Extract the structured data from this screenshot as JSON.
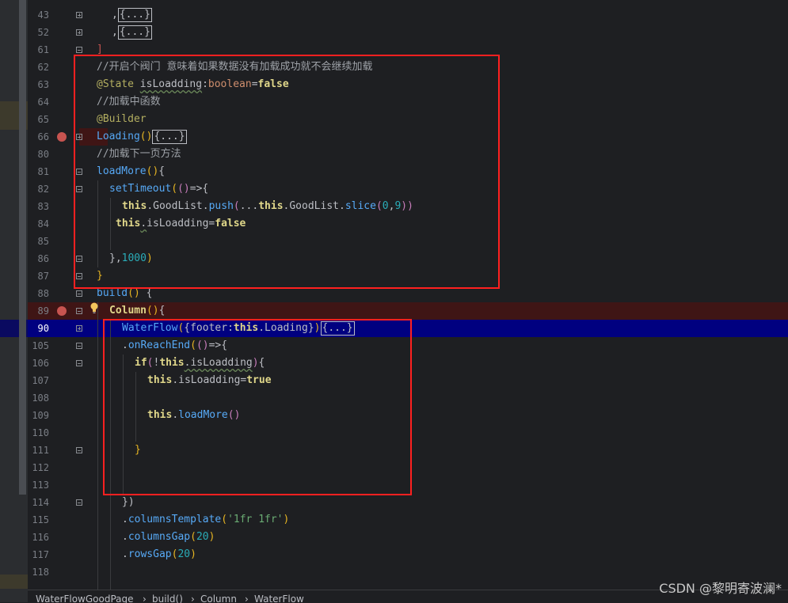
{
  "editor": {
    "lines": [
      {
        "num": "43",
        "tokens": [
          {
            "c": "plain",
            "t": ","
          },
          {
            "c": "fold",
            "t": "{...}"
          }
        ]
      },
      {
        "num": "52",
        "tokens": [
          {
            "c": "plain",
            "t": ","
          },
          {
            "c": "fold",
            "t": "{...}"
          }
        ]
      },
      {
        "num": "61",
        "tokens": [
          {
            "c": "redb",
            "t": "]"
          }
        ]
      },
      {
        "num": "62",
        "tokens": [
          {
            "c": "cmt",
            "t": "//开启个阀门 意味着如果数据没有加载成功就不会继续加载"
          }
        ]
      },
      {
        "num": "63",
        "tokens": [
          {
            "c": "ann",
            "t": "@State "
          },
          {
            "c": "plain",
            "t": "isLoadding"
          },
          {
            "c": "plain",
            "t": ":"
          },
          {
            "c": "kw",
            "t": "boolean"
          },
          {
            "c": "plain",
            "t": "="
          },
          {
            "c": "kwb",
            "t": "false"
          }
        ]
      },
      {
        "num": "64",
        "tokens": [
          {
            "c": "cmt",
            "t": "//加载中函数"
          }
        ]
      },
      {
        "num": "65",
        "tokens": [
          {
            "c": "ann",
            "t": "@Builder"
          }
        ]
      },
      {
        "num": "66",
        "tokens": [
          {
            "c": "fn",
            "t": "Loading"
          },
          {
            "c": "brk",
            "t": "()"
          },
          {
            "c": "fold",
            "t": "{...}"
          }
        ]
      },
      {
        "num": "80",
        "tokens": [
          {
            "c": "cmt",
            "t": "//加载下一页方法"
          }
        ]
      },
      {
        "num": "81",
        "tokens": [
          {
            "c": "fn",
            "t": "loadMore"
          },
          {
            "c": "brk",
            "t": "()"
          },
          {
            "c": "plain",
            "t": "{"
          }
        ]
      },
      {
        "num": "82",
        "tokens": [
          {
            "c": "fnc",
            "t": "setTimeout"
          },
          {
            "c": "brk",
            "t": "("
          },
          {
            "c": "purple",
            "t": "()"
          },
          {
            "c": "plain",
            "t": "=>{"
          }
        ]
      },
      {
        "num": "83",
        "tokens": [
          {
            "c": "kwb",
            "t": "this"
          },
          {
            "c": "plain",
            "t": ".GoodList."
          },
          {
            "c": "fnc",
            "t": "push"
          },
          {
            "c": "purple",
            "t": "("
          },
          {
            "c": "plain",
            "t": "..."
          },
          {
            "c": "kwb",
            "t": "this"
          },
          {
            "c": "plain",
            "t": ".GoodList."
          },
          {
            "c": "fnc",
            "t": "slice"
          },
          {
            "c": "purple",
            "t": "("
          },
          {
            "c": "num",
            "t": "0"
          },
          {
            "c": "plain",
            "t": ","
          },
          {
            "c": "num",
            "t": "9"
          },
          {
            "c": "purple",
            "t": "))"
          }
        ]
      },
      {
        "num": "84",
        "tokens": [
          {
            "c": "kwb",
            "t": "this"
          },
          {
            "c": "plain",
            "t": "."
          },
          {
            "c": "plain",
            "t": "isLoadding"
          },
          {
            "c": "plain",
            "t": "="
          },
          {
            "c": "kwb",
            "t": "false"
          }
        ]
      },
      {
        "num": "85",
        "tokens": []
      },
      {
        "num": "86",
        "tokens": [
          {
            "c": "plain",
            "t": "},"
          },
          {
            "c": "num",
            "t": "1000"
          },
          {
            "c": "brk",
            "t": ")"
          }
        ]
      },
      {
        "num": "87",
        "tokens": [
          {
            "c": "brk",
            "t": "}"
          }
        ]
      },
      {
        "num": "88",
        "tokens": [
          {
            "c": "fn",
            "t": "build"
          },
          {
            "c": "brk",
            "t": "() "
          },
          {
            "c": "plain",
            "t": "{"
          }
        ]
      },
      {
        "num": "89",
        "tokens": [
          {
            "c": "kwb",
            "t": "Column"
          },
          {
            "c": "brk",
            "t": "()"
          },
          {
            "c": "plain",
            "t": "{"
          }
        ]
      },
      {
        "num": "90",
        "tokens": [
          {
            "c": "fn",
            "t": "WaterFlow"
          },
          {
            "c": "brk",
            "t": "("
          },
          {
            "c": "plain",
            "t": "{footer:"
          },
          {
            "c": "kwb",
            "t": "this"
          },
          {
            "c": "plain",
            "t": ".Loading}"
          },
          {
            "c": "brk",
            "t": ")"
          },
          {
            "c": "fold",
            "t": "{...}"
          }
        ]
      },
      {
        "num": "105",
        "tokens": [
          {
            "c": "plain",
            "t": "."
          },
          {
            "c": "fnc",
            "t": "onReachEnd"
          },
          {
            "c": "brk",
            "t": "("
          },
          {
            "c": "purple",
            "t": "()"
          },
          {
            "c": "plain",
            "t": "=>{"
          }
        ]
      },
      {
        "num": "106",
        "tokens": [
          {
            "c": "kwb",
            "t": "if"
          },
          {
            "c": "purple",
            "t": "("
          },
          {
            "c": "plain",
            "t": "!"
          },
          {
            "c": "kwb",
            "t": "this"
          },
          {
            "c": "plain",
            "t": ".isLoadding"
          },
          {
            "c": "purple",
            "t": ")"
          },
          {
            "c": "plain",
            "t": "{"
          }
        ]
      },
      {
        "num": "107",
        "tokens": [
          {
            "c": "kwb",
            "t": "this"
          },
          {
            "c": "plain",
            "t": ".isLoadding="
          },
          {
            "c": "kwb",
            "t": "true"
          }
        ]
      },
      {
        "num": "108",
        "tokens": []
      },
      {
        "num": "109",
        "tokens": [
          {
            "c": "kwb",
            "t": "this"
          },
          {
            "c": "plain",
            "t": "."
          },
          {
            "c": "fnc",
            "t": "loadMore"
          },
          {
            "c": "purple",
            "t": "()"
          }
        ]
      },
      {
        "num": "110",
        "tokens": []
      },
      {
        "num": "111",
        "tokens": [
          {
            "c": "brk",
            "t": "}"
          }
        ]
      },
      {
        "num": "112",
        "tokens": []
      },
      {
        "num": "113",
        "tokens": []
      },
      {
        "num": "114",
        "tokens": [
          {
            "c": "plain",
            "t": "})"
          }
        ]
      },
      {
        "num": "115",
        "tokens": [
          {
            "c": "plain",
            "t": "."
          },
          {
            "c": "fnc",
            "t": "columnsTemplate"
          },
          {
            "c": "brk",
            "t": "("
          },
          {
            "c": "str",
            "t": "'1fr 1fr'"
          },
          {
            "c": "brk",
            "t": ")"
          }
        ]
      },
      {
        "num": "116",
        "tokens": [
          {
            "c": "plain",
            "t": "."
          },
          {
            "c": "fnc",
            "t": "columnsGap"
          },
          {
            "c": "brk",
            "t": "("
          },
          {
            "c": "num",
            "t": "20"
          },
          {
            "c": "brk",
            "t": ")"
          }
        ]
      },
      {
        "num": "117",
        "tokens": [
          {
            "c": "plain",
            "t": "."
          },
          {
            "c": "fnc",
            "t": "rowsGap"
          },
          {
            "c": "brk",
            "t": "("
          },
          {
            "c": "num",
            "t": "20"
          },
          {
            "c": "brk",
            "t": ")"
          }
        ]
      },
      {
        "num": "118",
        "tokens": []
      }
    ]
  },
  "breadcrumb": {
    "items": [
      "WaterFlowGoodPage",
      "build()",
      "Column",
      "WaterFlow"
    ],
    "separator": "›"
  },
  "watermark": "CSDN @黎明寄波澜*",
  "colors": {
    "highlight_box": "#ff2020",
    "current_line": "#000080",
    "breakpoint_line": "#3f1515",
    "breakpoint_dot": "#c75450"
  }
}
